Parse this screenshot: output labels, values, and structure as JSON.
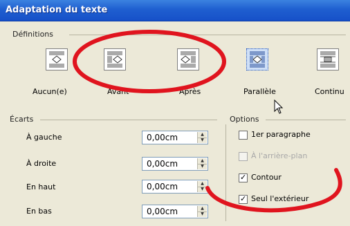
{
  "window": {
    "title": "Adaptation du texte"
  },
  "definitions": {
    "label": "Définitions",
    "options": [
      {
        "label": "Aucun(e)",
        "selected": false,
        "icon": "wrap-none-icon"
      },
      {
        "label": "Avant",
        "selected": false,
        "icon": "wrap-before-icon"
      },
      {
        "label": "Après",
        "selected": false,
        "icon": "wrap-after-icon"
      },
      {
        "label": "Parallèle",
        "selected": true,
        "icon": "wrap-parallel-icon"
      },
      {
        "label": "Continu",
        "selected": false,
        "icon": "wrap-through-icon"
      }
    ]
  },
  "spacing": {
    "label": "Écarts",
    "rows": [
      {
        "label": "À gauche",
        "value": "0,00cm"
      },
      {
        "label": "À droite",
        "value": "0,00cm"
      },
      {
        "label": "En haut",
        "value": "0,00cm"
      },
      {
        "label": "En bas",
        "value": "0,00cm"
      }
    ]
  },
  "options": {
    "label": "Options",
    "items": [
      {
        "label": "1er paragraphe",
        "checked": false,
        "enabled": true
      },
      {
        "label": "À l'arrière-plan",
        "checked": false,
        "enabled": false
      },
      {
        "label": "Contour",
        "checked": true,
        "enabled": true
      },
      {
        "label": "Seul l'extérieur",
        "checked": true,
        "enabled": true
      }
    ]
  },
  "annotation_color": "#e0141e"
}
